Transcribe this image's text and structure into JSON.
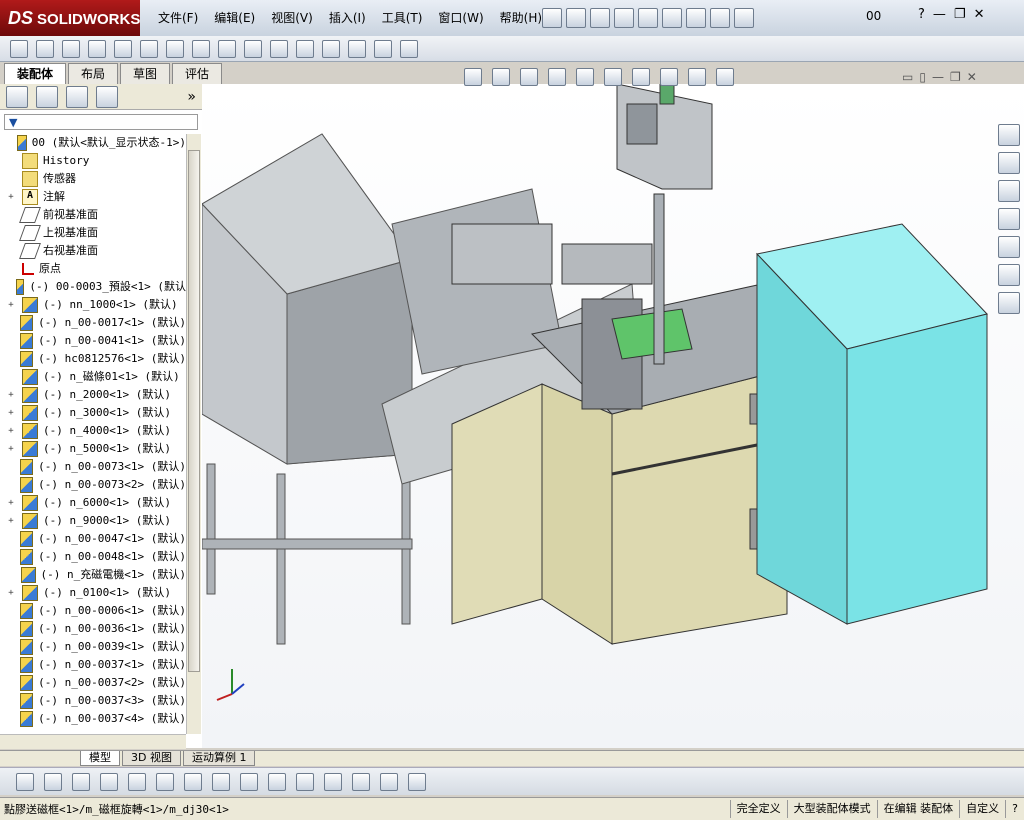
{
  "app": {
    "brand_prefix": "DS",
    "brand": "SOLIDWORKS",
    "document": "00"
  },
  "menu": [
    "文件(F)",
    "编辑(E)",
    "视图(V)",
    "插入(I)",
    "工具(T)",
    "窗口(W)",
    "帮助(H)"
  ],
  "window_controls": {
    "help": "?",
    "minimize": "—",
    "restore": "❐",
    "close": "✕"
  },
  "tabs": [
    {
      "label": "装配体",
      "active": true
    },
    {
      "label": "布局",
      "active": false
    },
    {
      "label": "草图",
      "active": false
    },
    {
      "label": "评估",
      "active": false
    }
  ],
  "panel": {
    "collapse": "»",
    "filter": "▼"
  },
  "tree": [
    {
      "label": "00  (默认<默认_显示状态-1>)",
      "icon": "assembly-icon",
      "expand": ""
    },
    {
      "label": "History",
      "icon": "history-icon",
      "expand": ""
    },
    {
      "label": "传感器",
      "icon": "sensor-icon",
      "expand": ""
    },
    {
      "label": "注解",
      "icon": "annotation-icon",
      "expand": "+"
    },
    {
      "label": "前视基准面",
      "icon": "plane-icon",
      "expand": ""
    },
    {
      "label": "上视基准面",
      "icon": "plane-icon",
      "expand": ""
    },
    {
      "label": "右视基准面",
      "icon": "plane-icon",
      "expand": ""
    },
    {
      "label": "原点",
      "icon": "origin-icon",
      "expand": ""
    },
    {
      "label": "(-) 00-0003_預設<1> (默认",
      "icon": "component-icon",
      "expand": ""
    },
    {
      "label": "(-) nn_1000<1> (默认)",
      "icon": "component-icon",
      "expand": "+"
    },
    {
      "label": "(-) n_00-0017<1> (默认)",
      "icon": "component-icon",
      "expand": ""
    },
    {
      "label": "(-) n_00-0041<1> (默认)",
      "icon": "component-icon",
      "expand": ""
    },
    {
      "label": "(-) hc0812576<1> (默认)",
      "icon": "component-icon",
      "expand": ""
    },
    {
      "label": "(-) n_磁條01<1> (默认)",
      "icon": "component-icon",
      "expand": ""
    },
    {
      "label": "(-) n_2000<1> (默认)",
      "icon": "component-icon",
      "expand": "+"
    },
    {
      "label": "(-) n_3000<1> (默认)",
      "icon": "component-icon",
      "expand": "+"
    },
    {
      "label": "(-) n_4000<1> (默认)",
      "icon": "component-icon",
      "expand": "+"
    },
    {
      "label": "(-) n_5000<1> (默认)",
      "icon": "component-icon",
      "expand": "+"
    },
    {
      "label": "(-) n_00-0073<1> (默认)",
      "icon": "component-icon",
      "expand": ""
    },
    {
      "label": "(-) n_00-0073<2> (默认)",
      "icon": "component-icon",
      "expand": ""
    },
    {
      "label": "(-) n_6000<1> (默认)",
      "icon": "component-icon",
      "expand": "+"
    },
    {
      "label": "(-) n_9000<1> (默认)",
      "icon": "component-icon",
      "expand": "+"
    },
    {
      "label": "(-) n_00-0047<1> (默认)",
      "icon": "component-icon",
      "expand": ""
    },
    {
      "label": "(-) n_00-0048<1> (默认)",
      "icon": "component-icon",
      "expand": ""
    },
    {
      "label": "(-) n_充磁電機<1> (默认)",
      "icon": "component-icon",
      "expand": ""
    },
    {
      "label": "(-) n_0100<1> (默认)",
      "icon": "component-icon",
      "expand": "+"
    },
    {
      "label": "(-) n_00-0006<1> (默认)",
      "icon": "component-icon",
      "expand": ""
    },
    {
      "label": "(-) n_00-0036<1> (默认)",
      "icon": "component-icon",
      "expand": ""
    },
    {
      "label": "(-) n_00-0039<1> (默认)",
      "icon": "component-icon",
      "expand": ""
    },
    {
      "label": "(-) n_00-0037<1> (默认)",
      "icon": "component-icon",
      "expand": ""
    },
    {
      "label": "(-) n_00-0037<2> (默认)",
      "icon": "component-icon",
      "expand": ""
    },
    {
      "label": "(-) n_00-0037<3> (默认)",
      "icon": "component-icon",
      "expand": ""
    },
    {
      "label": "(-) n_00-0037<4> (默认)",
      "icon": "component-icon",
      "expand": ""
    }
  ],
  "bottom_tabs": [
    {
      "label": "模型",
      "active": true
    },
    {
      "label": "3D 视图",
      "active": false
    },
    {
      "label": "运动算例 1",
      "active": false
    }
  ],
  "status": {
    "path": "點膠送磁框<1>/m_磁框旋轉<1>/m_dj30<1>",
    "cells": [
      "完全定义",
      "大型装配体模式",
      "在编辑 装配体",
      "自定义"
    ]
  },
  "colors": {
    "cabinet": "#ddd9b0",
    "frame": "#9aa0a8",
    "box": "#7ae3e6",
    "accent": "#1a4fa0"
  }
}
